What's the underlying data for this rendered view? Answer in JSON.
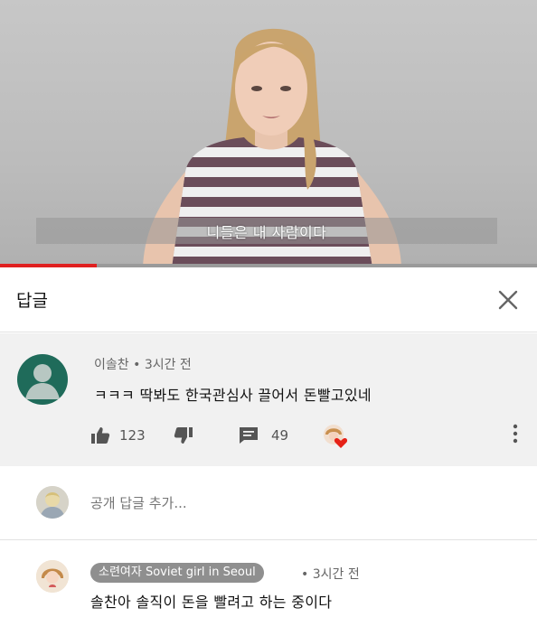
{
  "video": {
    "caption": "니들은 내 사람이다",
    "progress_fraction": 0.18
  },
  "replies_panel": {
    "title": "답글",
    "close_icon": "close-icon"
  },
  "comment": {
    "author": "이솔찬",
    "separator": "•",
    "time": "3시간 전",
    "text": "ㅋㅋㅋ 딱봐도 한국관심사 끌어서 돈빨고있네",
    "likes": "123",
    "dislikes": "49",
    "avatar_color": "#1f6b5a",
    "icons": {
      "like": "thumbs-up-icon",
      "dislike": "thumbs-down-icon",
      "reply": "reply-icon",
      "more": "more-vert-icon",
      "creator_heart": "creator-heart-icon"
    },
    "heart_color": "#e62117"
  },
  "add_reply": {
    "placeholder": "공개 답글 추가..."
  },
  "reply": {
    "author": "소련여자 Soviet girl in Seoul",
    "separator": "•",
    "time": "3시간 전",
    "text": "솔찬아 솔직이 돈을 빨려고 하는 중이다"
  },
  "colors": {
    "accent_red": "#e02020",
    "comment_bg": "#f1f1f1",
    "author_badge_bg": "#8f8f8f"
  }
}
